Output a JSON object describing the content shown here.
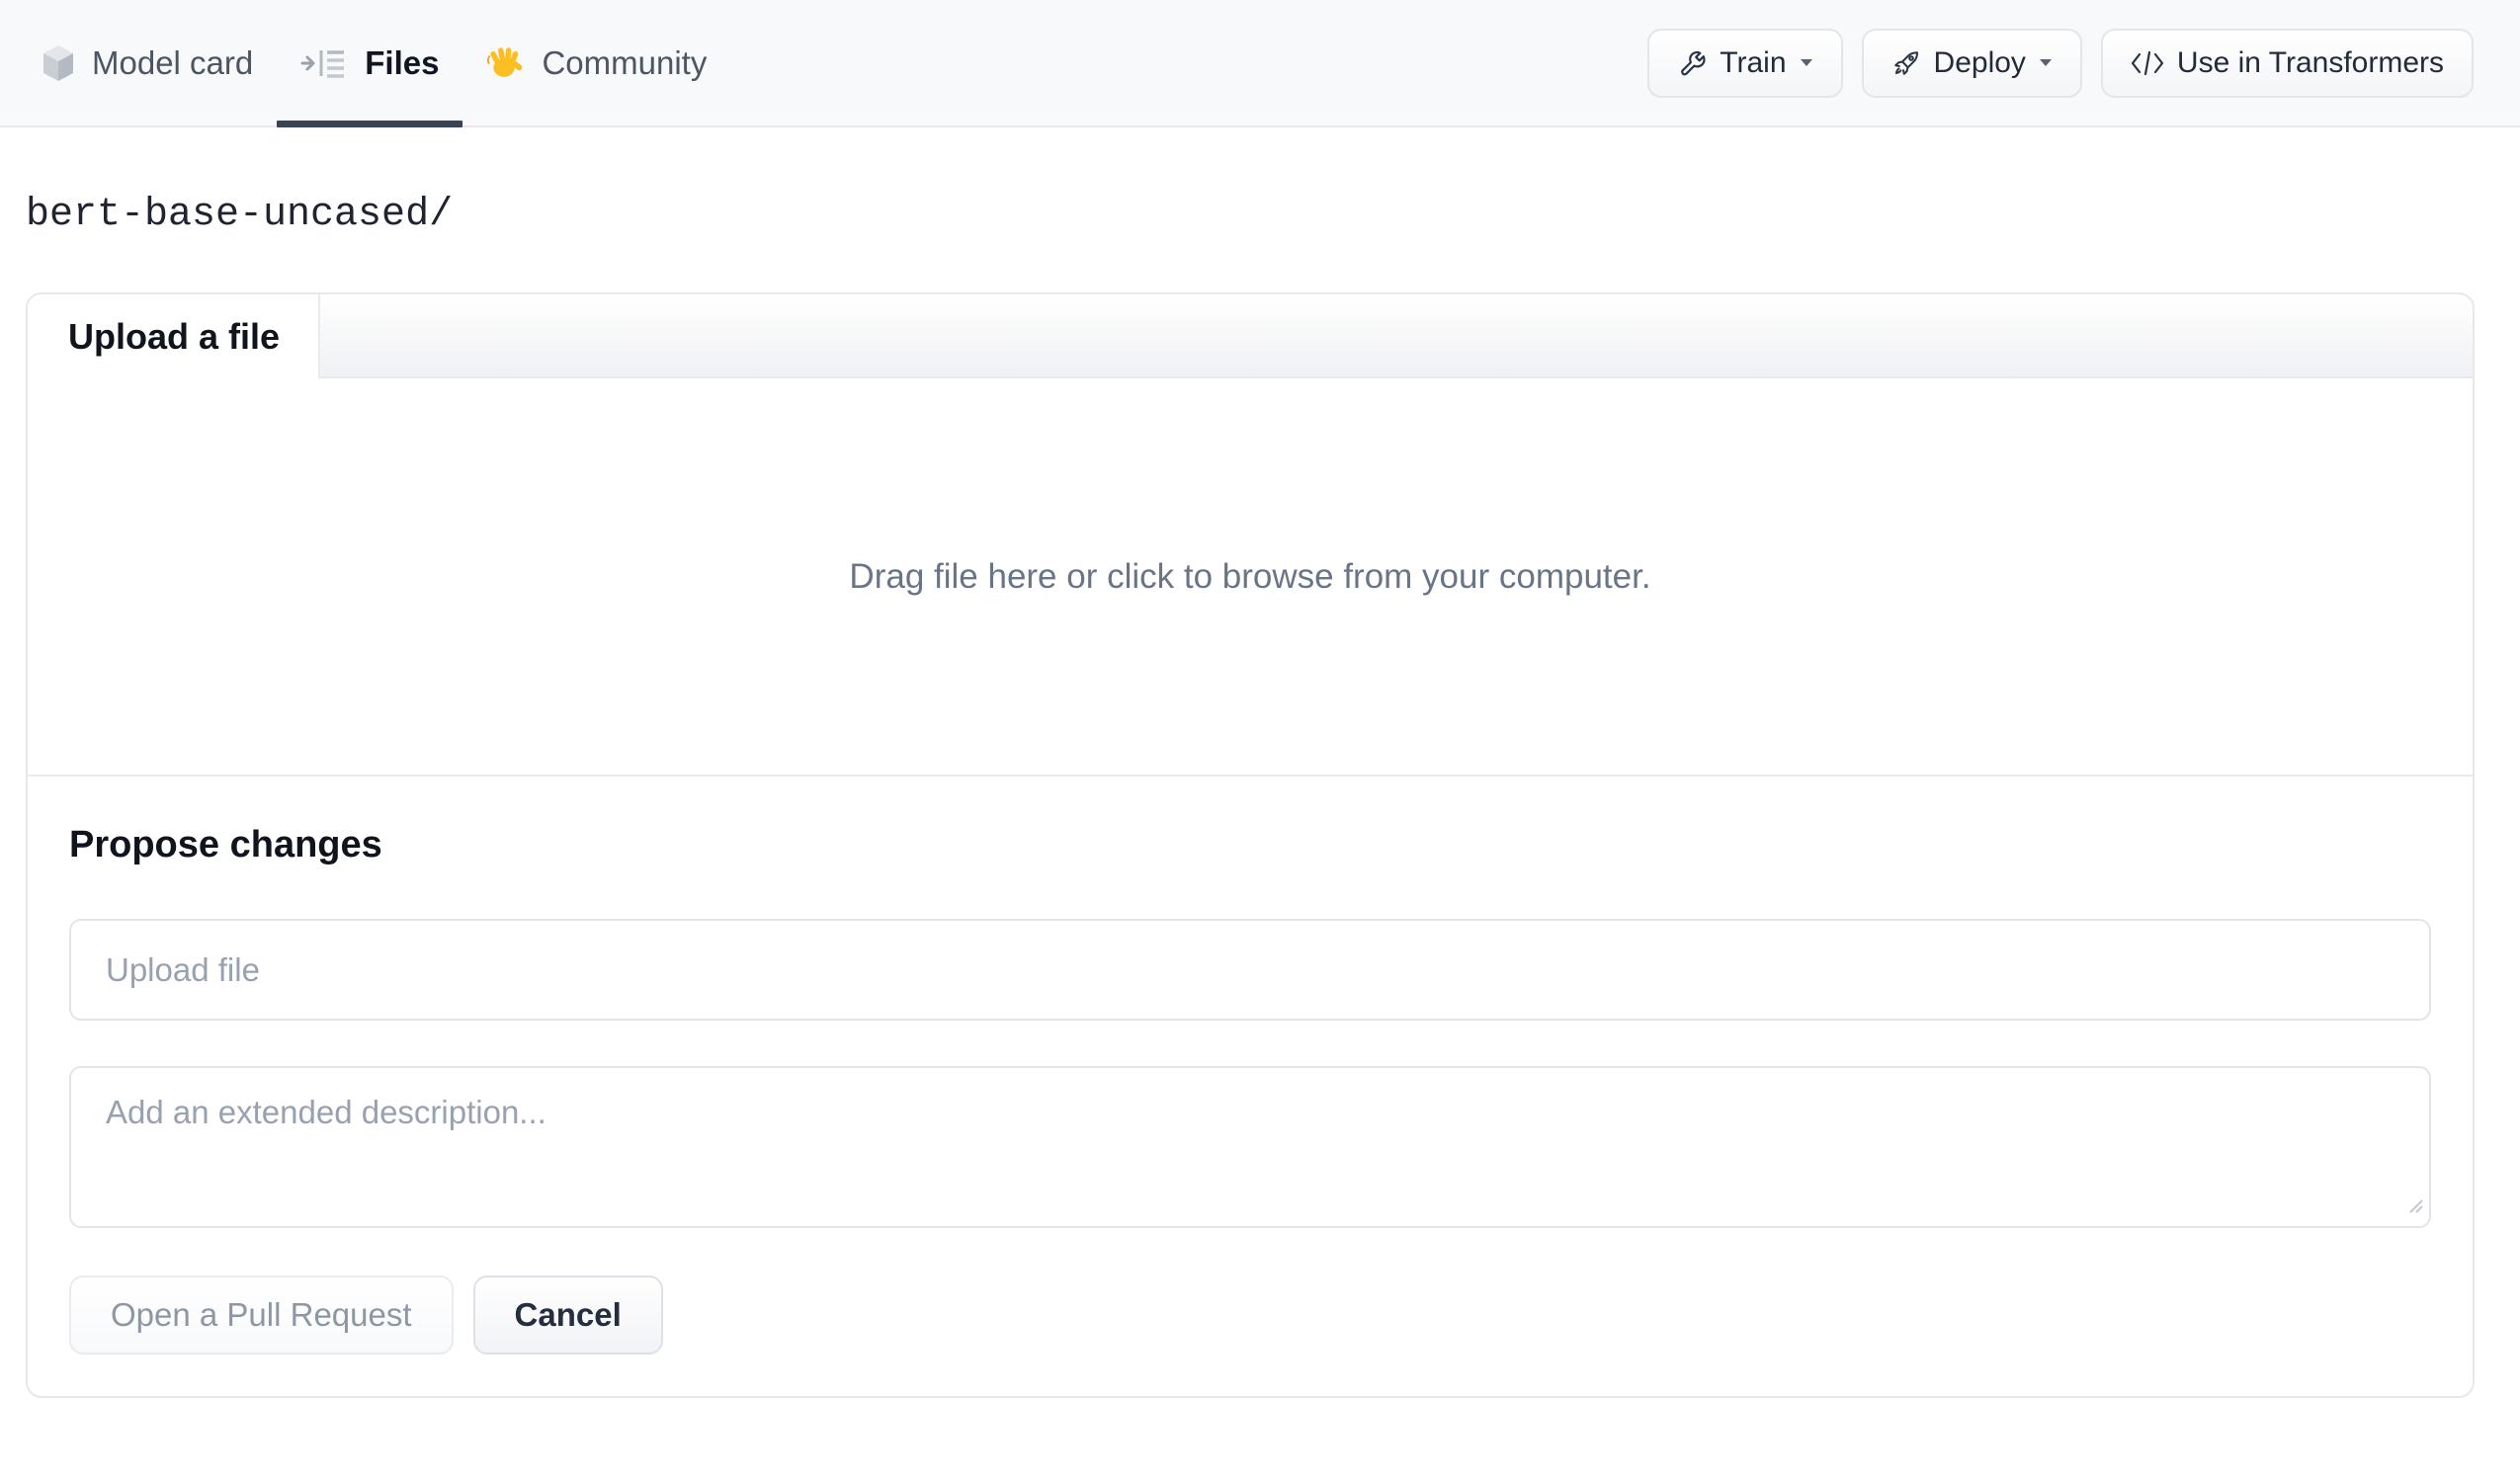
{
  "nav": {
    "tabs": [
      {
        "label": "Model card",
        "icon": "cube-icon",
        "active": false
      },
      {
        "label": "Files",
        "icon": "file-tree-icon",
        "active": true
      },
      {
        "label": "Community",
        "icon": "waving-hand-icon",
        "active": false
      }
    ],
    "actions": [
      {
        "label": "Train",
        "icon": "wrench-icon",
        "has_dropdown": true
      },
      {
        "label": "Deploy",
        "icon": "rocket-icon",
        "has_dropdown": true
      },
      {
        "label": "Use in Transformers",
        "icon": "code-icon",
        "has_dropdown": false
      }
    ]
  },
  "breadcrumb": {
    "path": "bert-base-uncased/"
  },
  "upload_card": {
    "tab_label": "Upload a file",
    "dropzone_text": "Drag file here or click to browse from your computer.",
    "propose_heading": "Propose changes",
    "file_input_placeholder": "Upload file",
    "file_input_value": "",
    "description_placeholder": "Add an extended description...",
    "description_value": "",
    "submit_label": "Open a Pull Request",
    "submit_enabled": false,
    "cancel_label": "Cancel"
  },
  "colors": {
    "nav_background": "#f8f9fb",
    "active_tab_underline": "#3a4354",
    "border": "#e6e8ec",
    "text_primary": "#10141c",
    "text_secondary": "#4b5563",
    "text_muted": "#697586",
    "placeholder": "#98a1b0",
    "disabled_text": "#8d97a4",
    "emoji_yellow": "#fbbf24"
  }
}
